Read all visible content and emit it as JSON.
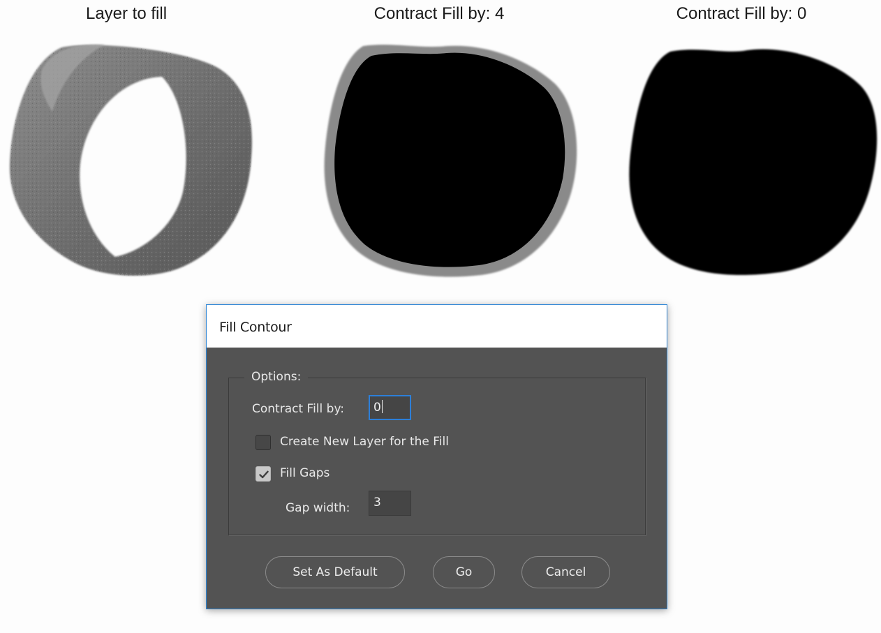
{
  "captions": {
    "left": "Layer to fill",
    "middle": "Contract Fill by: 4",
    "right": "Contract Fill by: 0"
  },
  "dialog": {
    "title": "Fill Contour",
    "options_legend": "Options:",
    "contract_label": "Contract Fill by:",
    "contract_value": "0",
    "new_layer_label": "Create New Layer for the Fill",
    "new_layer_checked": false,
    "fill_gaps_label": "Fill Gaps",
    "fill_gaps_checked": true,
    "gap_width_label": "Gap width:",
    "gap_width_value": "3",
    "buttons": {
      "default": "Set As Default",
      "go": "Go",
      "cancel": "Cancel"
    },
    "accent_color": "#2d7fd8",
    "panel_color": "#535353"
  },
  "icons": {
    "checkmark": "checkmark-icon"
  }
}
